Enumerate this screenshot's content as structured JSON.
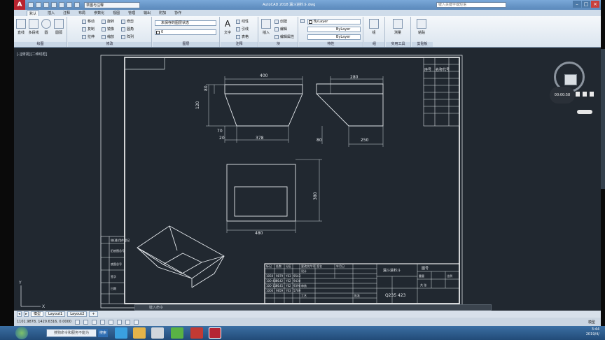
{
  "app": {
    "logo": "A",
    "workspace": "草图与注释",
    "title": "AutoCAD 2018  漏斗进料斗.dwg",
    "search_placeholder": "键入关键字或短语"
  },
  "tabs": [
    "默认",
    "插入",
    "注释",
    "布局",
    "参数化",
    "视图",
    "管理",
    "输出",
    "附加",
    "协作"
  ],
  "ribbon": {
    "draw": {
      "title": "绘图",
      "line": "直线",
      "polyline": "多段线",
      "circle": "圆",
      "arc": "圆弧"
    },
    "modify": {
      "title": "修改",
      "move": "移动",
      "rotate": "旋转",
      "trim": "修剪",
      "copy": "复制",
      "mirror": "镜像",
      "fillet": "圆角",
      "stretch": "拉伸",
      "scale": "缩放",
      "array": "阵列"
    },
    "layers": {
      "title": "图层",
      "layer_state": "未保存的图层状态",
      "layer_current": "0"
    },
    "annotation": {
      "title": "注释",
      "text": "文字",
      "linear": "线性",
      "leader": "引线",
      "table": "表格"
    },
    "block": {
      "title": "块",
      "insert": "插入",
      "create": "创建",
      "edit": "编辑",
      "edit_attr": "编辑属性"
    },
    "properties": {
      "title": "特性",
      "color": "ByLayer",
      "linetype": "ByLayer",
      "lineweight": "ByLayer"
    },
    "groups": {
      "title": "组",
      "group": "组"
    },
    "utilities": {
      "title": "实用工具",
      "measure": "测量"
    },
    "clipboard": {
      "title": "剪贴板",
      "paste": "粘贴"
    }
  },
  "viewport_label": "[-][俯视][二维线框]",
  "drawing": {
    "dims": {
      "front_top": "400",
      "front_height": "120",
      "front_left_small": "80",
      "front_bottom_small": "70",
      "front_bottom": "378",
      "front_small_left": "20",
      "side_top": "280",
      "side_bottom": "250",
      "side_small": "80",
      "top_width": "480",
      "top_height": "380"
    },
    "parts_list": {
      "col1": "序号",
      "col2": "名称代号"
    },
    "title_block": {
      "name": "漏斗进料斗",
      "sheet": "图号",
      "material": "Q235",
      "qty": "423",
      "scale": "比例",
      "weight": "重量",
      "sheet_count": "共 张",
      "designer": "设计",
      "checker": "审核",
      "process": "工艺",
      "approve": "批准",
      "rev_cells": [
        "标记",
        "处数",
        "分区",
        "更改文件号",
        "签名",
        "年月日"
      ],
      "rows": [
        [
          "1050",
          "9879",
          "Y63",
          "9543"
        ],
        [
          "100-400",
          "9142",
          "Y62",
          "9430"
        ],
        [
          "100-150",
          "9145",
          "Y62",
          "9390"
        ],
        [
          "1000",
          "9859",
          "Y63",
          "5789"
        ]
      ]
    },
    "side_strip": [
      "借(通)用件登记",
      "旧底图总号",
      "底图总号",
      "签字",
      "日期"
    ]
  },
  "command_placeholder": "键入命令",
  "model_tabs": [
    "模型",
    "Layout1",
    "Layout2"
  ],
  "status": {
    "coords": "1101.9878, 1420.6316, 0.0000",
    "mode": "模型"
  },
  "recorder": {
    "time": "00:00:58"
  },
  "taskbar": {
    "search": "搜狗命令和服务不能为",
    "search_button": "搜索",
    "clock": "3:44",
    "date": "2019/4/"
  }
}
